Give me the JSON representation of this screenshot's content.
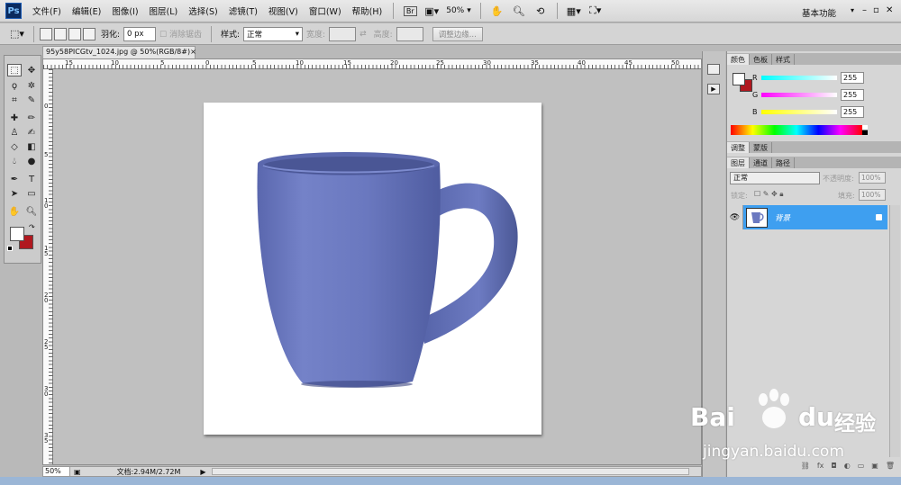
{
  "app": {
    "logo": "Ps"
  },
  "menu": [
    "文件(F)",
    "编辑(E)",
    "图像(I)",
    "图层(L)",
    "选择(S)",
    "滤镜(T)",
    "视图(V)",
    "窗口(W)",
    "帮助(H)"
  ],
  "app_bar": {
    "bridge": "Br",
    "zoom": "50%",
    "workspace": "基本功能"
  },
  "options": {
    "feather_label": "羽化:",
    "feather_value": "0 px",
    "antialias_label": "消除锯齿",
    "style_label": "样式:",
    "style_value": "正常",
    "width_label": "宽度:",
    "height_label": "高度:",
    "refine_button": "调整边缘..."
  },
  "document": {
    "tab_title": "95y58PICGtv_1024.jpg @ 50%(RGB/8#)",
    "close": "×",
    "ruler_top": [
      "15",
      "10",
      "5",
      "0",
      "5",
      "10",
      "15",
      "20",
      "25",
      "30",
      "35",
      "40",
      "45",
      "50"
    ],
    "ruler_left": [
      "0",
      "5",
      "1 0",
      "1 5",
      "2 0",
      "2 5",
      "3 0",
      "3 5"
    ]
  },
  "status": {
    "zoom": "50%",
    "doc_info": "文档:2.94M/2.72M"
  },
  "color_panel": {
    "tabs": [
      "颜色",
      "色板",
      "样式"
    ],
    "channels": [
      {
        "label": "R",
        "value": "255"
      },
      {
        "label": "G",
        "value": "255"
      },
      {
        "label": "B",
        "value": "255"
      }
    ]
  },
  "adjust_panel": {
    "tabs": [
      "调整",
      "蒙版"
    ]
  },
  "layers_panel": {
    "tabs": [
      "图层",
      "通道",
      "路径"
    ],
    "blend_mode": "正常",
    "opacity_label": "不透明度:",
    "opacity_value": "100%",
    "lock_label": "锁定:",
    "fill_label": "填充:",
    "fill_value": "100%",
    "layer_name": "背景"
  },
  "watermark": {
    "brand_left": "Bai",
    "brand_right": "du",
    "brand_cn": "经验",
    "url": "jingyan.baidu.com"
  },
  "colors": {
    "mug": "#6b79c0",
    "layer_selected": "#3e9ff0",
    "swatch_bg": "#b0181f"
  }
}
